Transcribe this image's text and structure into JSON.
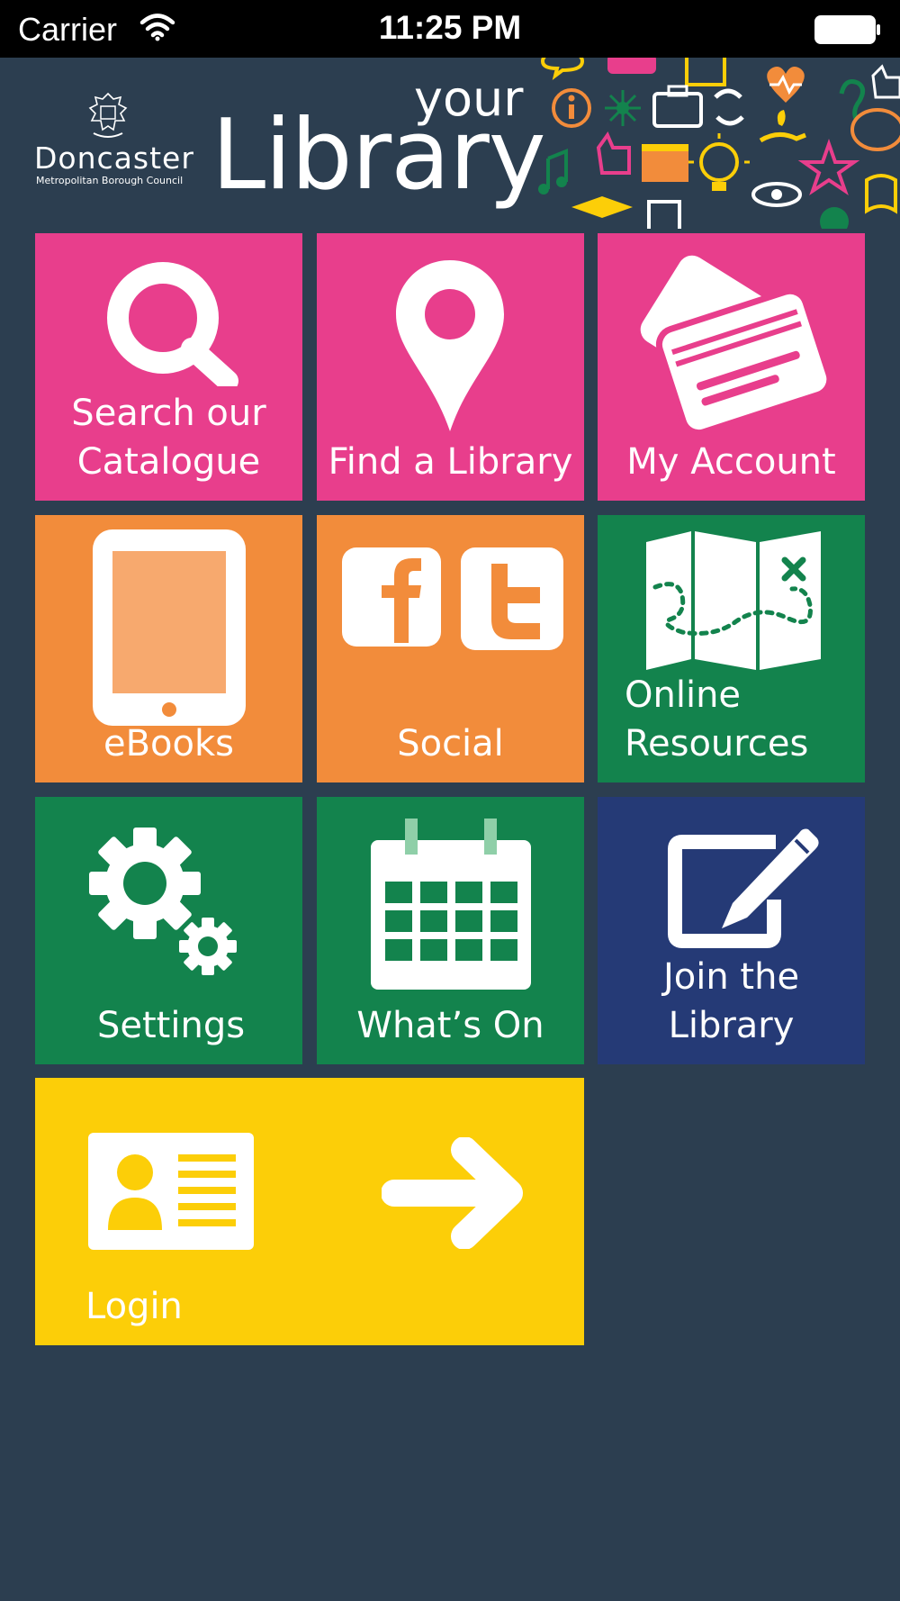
{
  "status_bar": {
    "carrier": "Carrier",
    "time": "11:25 PM"
  },
  "header": {
    "council_name": "Doncaster",
    "council_subtitle": "Metropolitan Borough Council",
    "title_small": "your",
    "title_large": "Library"
  },
  "tiles": {
    "search": {
      "label_line1": "Search our",
      "label_line2": "Catalogue",
      "icon": "magnifier-icon"
    },
    "find": {
      "label": "Find a Library",
      "icon": "map-pin-icon"
    },
    "account": {
      "label": "My Account",
      "icon": "library-cards-icon"
    },
    "ebooks": {
      "label": "eBooks",
      "icon": "tablet-icon"
    },
    "social": {
      "label": "Social",
      "icon": "facebook-twitter-icon"
    },
    "online": {
      "label_line1": "Online",
      "label_line2": "Resources",
      "icon": "treasure-map-icon"
    },
    "settings": {
      "label": "Settings",
      "icon": "gears-icon"
    },
    "whats_on": {
      "label": "What’s On",
      "icon": "calendar-icon"
    },
    "join": {
      "label_line1": "Join the",
      "label_line2": "Library",
      "icon": "edit-form-icon"
    },
    "login": {
      "label": "Login",
      "icon": "id-card-icon"
    }
  },
  "colors": {
    "background": "#2c3e50",
    "pink": "#e83e8c",
    "orange": "#f28c3b",
    "green": "#13834d",
    "navy": "#253a76",
    "yellow": "#fcce08"
  }
}
